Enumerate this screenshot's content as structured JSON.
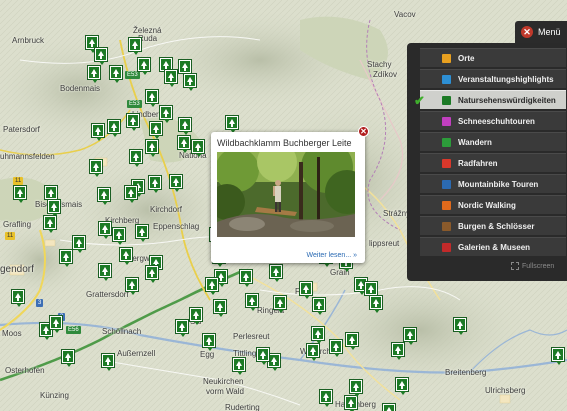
{
  "map": {
    "places": [
      {
        "label": "Železná",
        "id": "zelezna"
      },
      {
        "label": "Ruda",
        "id": "ruda"
      },
      {
        "label": "Arnbruck",
        "id": "arnbruck"
      },
      {
        "label": "Bodenmais",
        "id": "bodenmais"
      },
      {
        "label": "Patersdorf",
        "id": "patersdorf"
      },
      {
        "label": "Lindberg",
        "id": "lindberg"
      },
      {
        "label": "uhmannsfelden",
        "id": "ruhmannsfelden"
      },
      {
        "label": "Bischofsmais",
        "id": "bischofsmais"
      },
      {
        "label": "Kirchberg",
        "id": "kirchberg"
      },
      {
        "label": "Kirchdorf",
        "id": "kirchdorf"
      },
      {
        "label": "Eppenschlag",
        "id": "eppenschlag"
      },
      {
        "label": "Grafling",
        "id": "grafling"
      },
      {
        "label": "gendorf",
        "id": "deggendorf"
      },
      {
        "label": "Grattersdorf",
        "id": "grattersdorf"
      },
      {
        "label": "Schöllnach",
        "id": "schoellnach"
      },
      {
        "label": "Außernzell",
        "id": "aussernzell"
      },
      {
        "label": "Moos",
        "id": "moos"
      },
      {
        "label": "Osterhofen",
        "id": "osterhofen"
      },
      {
        "label": "Künzing",
        "id": "kuenzing"
      },
      {
        "label": "Egg",
        "id": "egg"
      },
      {
        "label": "Ringela",
        "id": "ringelai"
      },
      {
        "label": "Perlesreut",
        "id": "perlesreut"
      },
      {
        "label": "Tittling",
        "id": "tittling"
      },
      {
        "label": "Wallerchen",
        "id": "walderchen"
      },
      {
        "label": "Neukirchen",
        "id": "neukirchen"
      },
      {
        "label": "vorm Wald",
        "id": "vorm-wald"
      },
      {
        "label": "Ruderting",
        "id": "ruderting"
      },
      {
        "label": "Breitenberg",
        "id": "breitenberg"
      },
      {
        "label": "Ulrichsberg",
        "id": "ulrichsberg"
      },
      {
        "label": "Stachy",
        "id": "stachy"
      },
      {
        "label": "Zdíkov",
        "id": "zdikov"
      },
      {
        "label": "Vacov",
        "id": "vacov"
      },
      {
        "label": "Strážný",
        "id": "strazny"
      },
      {
        "label": "lippsreut",
        "id": "philippsreut"
      },
      {
        "label": "Frag",
        "id": "freyung"
      },
      {
        "label": "Nationa",
        "id": "nationalpark"
      },
      {
        "label": "Haizenberg",
        "id": "hauzenberg"
      },
      {
        "label": "Bergwa",
        "id": "bergwa"
      },
      {
        "label": "Sal",
        "id": "saldenburg"
      },
      {
        "label": "Grain",
        "id": "grainet"
      }
    ],
    "road_shields": [
      "E53",
      "E53",
      "11",
      "11",
      "3",
      "E56",
      "3"
    ]
  },
  "menu": {
    "button_label": "Menü",
    "close_glyph": "✕",
    "items": [
      {
        "label": "Orte",
        "icon": "place-icon",
        "color": "#e8a020",
        "active": false
      },
      {
        "label": "Veranstaltungshighlights",
        "icon": "event-icon",
        "color": "#2d8fd4",
        "active": false
      },
      {
        "label": "Natursehenswürdigkeiten",
        "icon": "tree-icon",
        "color": "#1c7a25",
        "active": true
      },
      {
        "label": "Schneeschuhtouren",
        "icon": "snowshoe-icon",
        "color": "#c13fbf",
        "active": false
      },
      {
        "label": "Wandern",
        "icon": "hiking-icon",
        "color": "#2c9c3a",
        "active": false
      },
      {
        "label": "Radfahren",
        "icon": "bike-icon",
        "color": "#d9382b",
        "active": false
      },
      {
        "label": "Mountainbike Touren",
        "icon": "mountainbike-icon",
        "color": "#2b6ab1",
        "active": false
      },
      {
        "label": "Nordic Walking",
        "icon": "nordic-walking-icon",
        "color": "#e06a1c",
        "active": false
      },
      {
        "label": "Burgen & Schlösser",
        "icon": "castle-icon",
        "color": "#8a5a2b",
        "active": false
      },
      {
        "label": "Galerien & Museen",
        "icon": "museum-icon",
        "color": "#c22a2a",
        "active": false
      }
    ],
    "check_glyph": "✔",
    "fullscreen_label": "Fullscreen"
  },
  "popup": {
    "title": "Wildbachklamm Buchberger Leite",
    "more_link": "Weiter lesen... »",
    "close_glyph": "✕"
  }
}
